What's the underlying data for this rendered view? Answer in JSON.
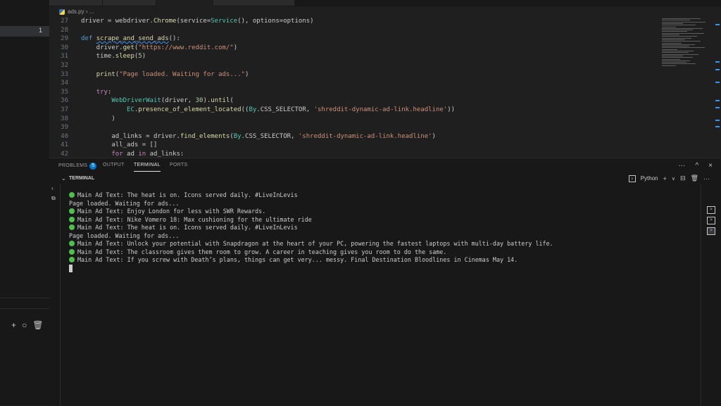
{
  "breadcrumb": {
    "file": "ads.py",
    "sep": "›",
    "rest": "..."
  },
  "sidebar": {
    "badge": "1",
    "controls": [
      "+",
      "○",
      "🗑"
    ]
  },
  "editor": {
    "lines": [
      {
        "n": "27",
        "t": "driver = webdriver.Chrome(service=Service(), options=options)"
      },
      {
        "n": "28",
        "t": ""
      },
      {
        "n": "29",
        "t": "def scrape_and_send_ads():"
      },
      {
        "n": "30",
        "t": "    driver.get(\"https://www.reddit.com/\")"
      },
      {
        "n": "31",
        "t": "    time.sleep(5)"
      },
      {
        "n": "32",
        "t": ""
      },
      {
        "n": "33",
        "t": "    print(\"Page loaded. Waiting for ads...\")"
      },
      {
        "n": "34",
        "t": ""
      },
      {
        "n": "35",
        "t": "    try:"
      },
      {
        "n": "36",
        "t": "        WebDriverWait(driver, 30).until("
      },
      {
        "n": "37",
        "t": "            EC.presence_of_element_located((By.CSS_SELECTOR, 'shreddit-dynamic-ad-link.headline'))"
      },
      {
        "n": "38",
        "t": "        )"
      },
      {
        "n": "39",
        "t": ""
      },
      {
        "n": "40",
        "t": "        ad_links = driver.find_elements(By.CSS_SELECTOR, 'shreddit-dynamic-ad-link.headline')"
      },
      {
        "n": "41",
        "t": "        all_ads = []"
      },
      {
        "n": "42",
        "t": "        for ad in ad_links:"
      }
    ]
  },
  "panel": {
    "tabs": [
      {
        "label": "PROBLEMS",
        "badge": "5"
      },
      {
        "label": "OUTPUT"
      },
      {
        "label": "TERMINAL",
        "active": true
      },
      {
        "label": "PORTS"
      }
    ],
    "more": "···",
    "maximize": "^",
    "close": "×",
    "terminal_header": "TERMINAL",
    "terminal_profile": "Python",
    "new_terminal": "+",
    "dropdown": "∨",
    "split": "⊟",
    "trash": "🗑",
    "terminal_more": "···"
  },
  "terminal": {
    "lines": [
      {
        "dot": true,
        "text": "Main Ad Text: The heat is on. Icons served daily. #LiveInLevis"
      },
      {
        "dot": false,
        "text": "Page loaded. Waiting for ads..."
      },
      {
        "dot": true,
        "text": "Main Ad Text: Enjoy London for less with SWR Rewards."
      },
      {
        "dot": true,
        "text": "Main Ad Text: Nike Vomero 18: Max cushioning for the ultimate ride"
      },
      {
        "dot": true,
        "text": "Main Ad Text: The heat is on. Icons served daily. #LiveInLevis"
      },
      {
        "dot": false,
        "text": "Page loaded. Waiting for ads..."
      },
      {
        "dot": true,
        "text": "Main Ad Text: Unlock your potential with Snapdragon at the heart of your PC, powering the fastest laptops with multi-day battery life."
      },
      {
        "dot": true,
        "text": "Main Ad Text: The classroom gives them room to grow. A career in teaching gives you room to do the same."
      },
      {
        "dot": true,
        "text": "Main Ad Text: If you screw with Death’s plans, things can get very... messy. Final Destination Bloodlines in Cinemas May 14."
      }
    ]
  },
  "colors": {
    "bg": "#1e1e1e",
    "panel": "#181818",
    "accent": "#0078d4",
    "green_dot": "#4fbf4f"
  }
}
